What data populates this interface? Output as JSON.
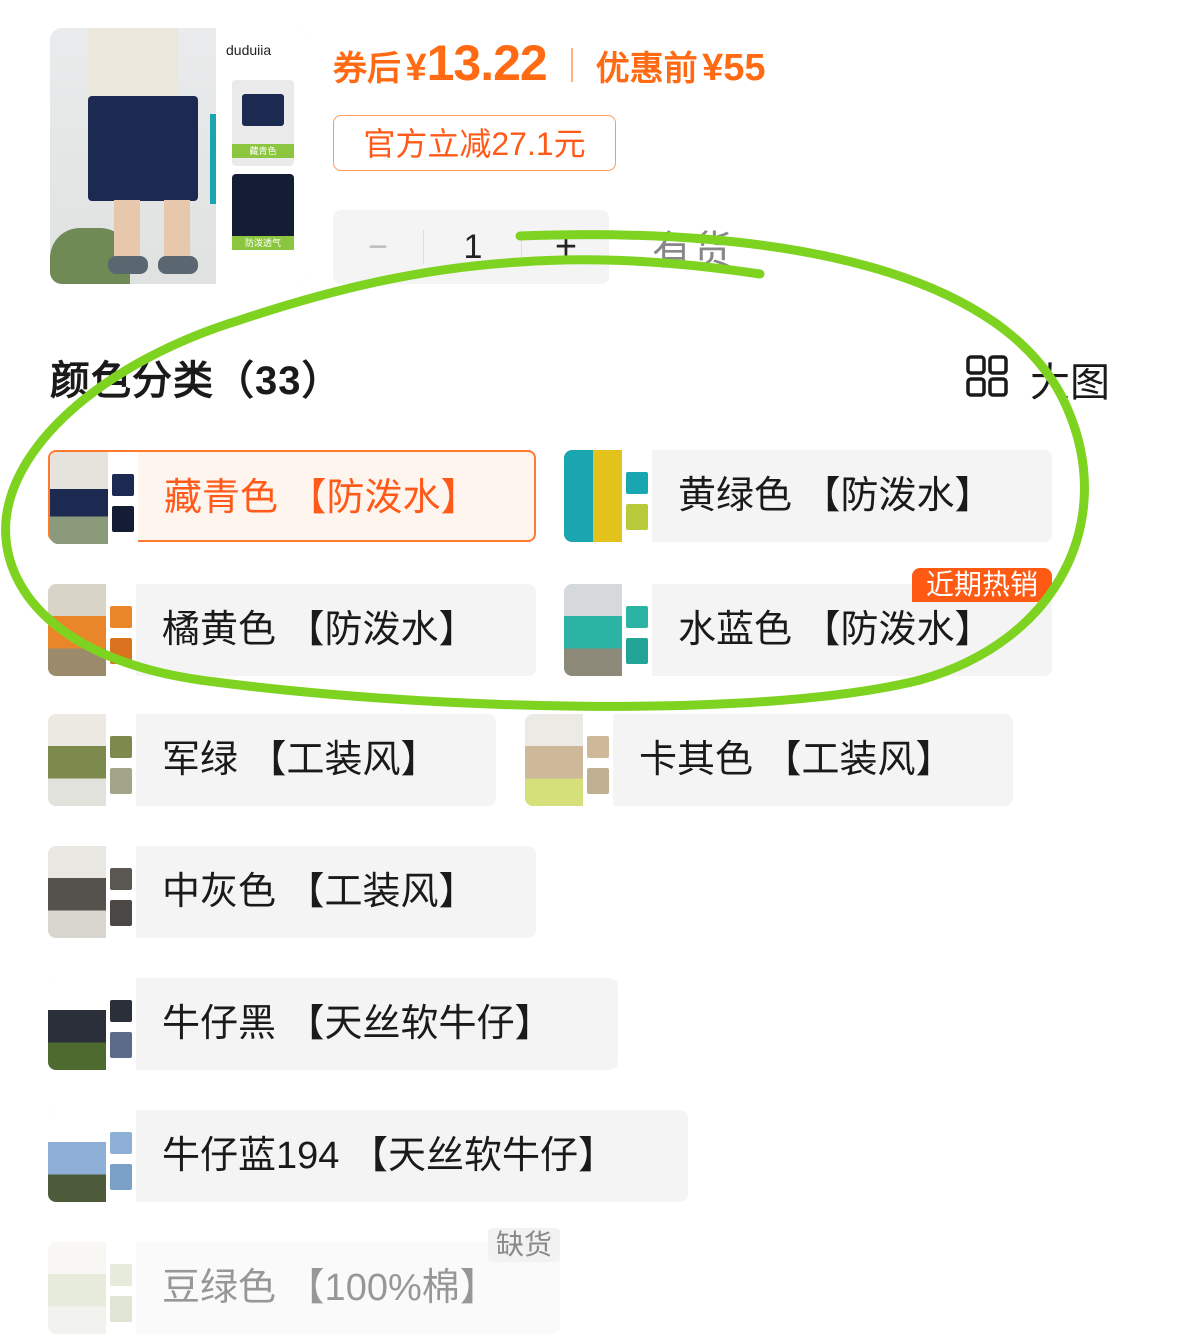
{
  "product": {
    "brand": "duduiia",
    "swatch_tags": [
      "藏青色",
      "防泼透气"
    ]
  },
  "price": {
    "after_coupon_label": "券后",
    "currency": "¥",
    "after_coupon_value": "13.22",
    "before_label": "优惠前",
    "before_value": "55",
    "coupon_text": "官方立减27.1元"
  },
  "stepper": {
    "minus": "−",
    "quantity": "1",
    "plus": "+"
  },
  "stock_text": "有货",
  "section": {
    "title": "颜色分类（33）",
    "view_toggle_label": "大图"
  },
  "variants": [
    {
      "label": "藏青色 【防泼水】",
      "selected": true
    },
    {
      "label": "黄绿色 【防泼水】"
    },
    {
      "label": "橘黄色 【防泼水】"
    },
    {
      "label": "水蓝色 【防泼水】",
      "badge": "近期热销"
    },
    {
      "label": "军绿 【工装风】"
    },
    {
      "label": "卡其色 【工装风】"
    },
    {
      "label": "中灰色 【工装风】"
    },
    {
      "label": "牛仔黑 【天丝软牛仔】"
    },
    {
      "label": "牛仔蓝194 【天丝软牛仔】"
    },
    {
      "label": "豆绿色 【100%棉】",
      "badge": "缺货",
      "disabled": true
    }
  ],
  "colors": {
    "accent": "#ff6a13",
    "highlight_ring": "#7ed321",
    "chip_bg": "#f4f4f4"
  }
}
